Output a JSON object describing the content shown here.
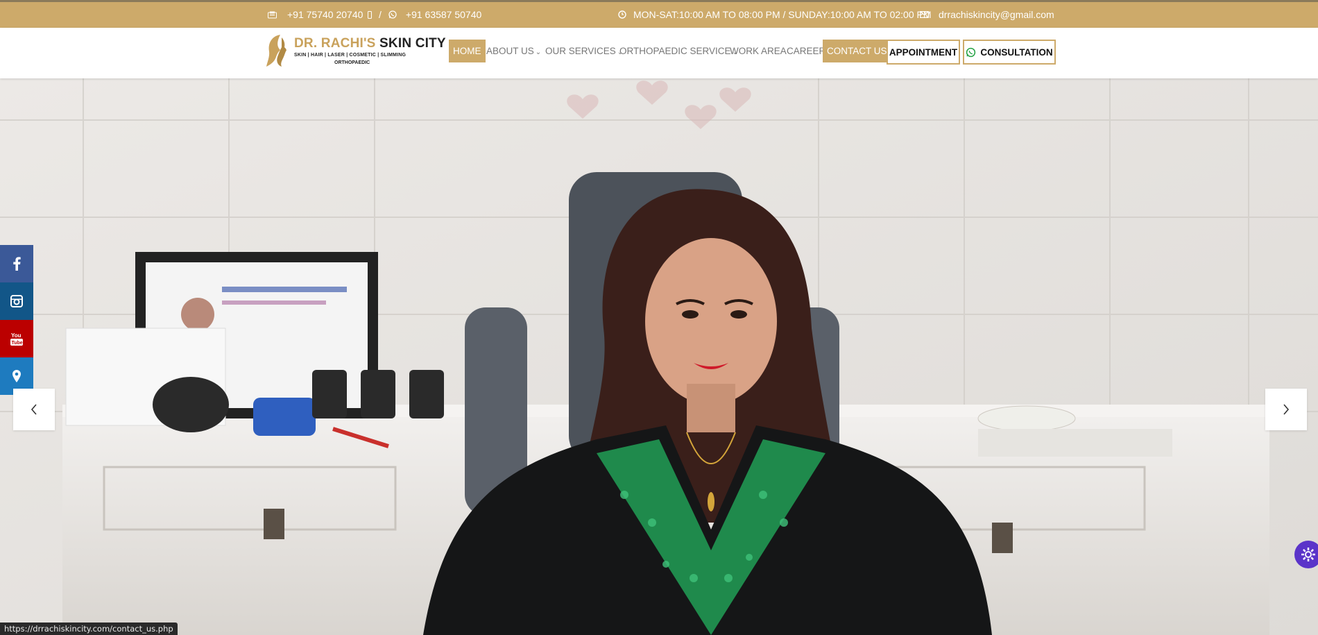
{
  "topbar": {
    "phone1": "+91 75740 20740",
    "separator": "/",
    "phone2": "+91 63587 50740",
    "hours": "MON-SAT:10:00 AM TO 08:00 PM / SUNDAY:10:00 AM TO 02:00 PM",
    "email": "drrachiskincity@gmail.com"
  },
  "logo": {
    "name_part1": "DR. RACHI'S",
    "name_part2": "SKIN CITY",
    "tagline": "SKIN | HAIR | LASER | COSMETIC | SLIMMING",
    "tagline2": "ORTHOPAEDIC"
  },
  "nav": {
    "home": "HOME",
    "about": "ABOUT US",
    "services": "OUR SERVICES",
    "ortho": "ORTHOPAEDIC SERVICE",
    "work_area": "WORK AREA",
    "career": "CAREER",
    "contact": "CONTACT US",
    "appointment": "APPOINTMENT",
    "consultation": "CONSULTATION"
  },
  "social": [
    "facebook-icon",
    "instagram-icon",
    "youtube-icon",
    "location-icon"
  ],
  "colors": {
    "gold": "#cdaa6a",
    "facebook": "#3b5998",
    "instagram": "#125688",
    "youtube": "#bb0000",
    "location": "#1e7bbf",
    "fab": "#5b34c9"
  },
  "status_url": "https://drrachiskincity.com/contact_us.php"
}
